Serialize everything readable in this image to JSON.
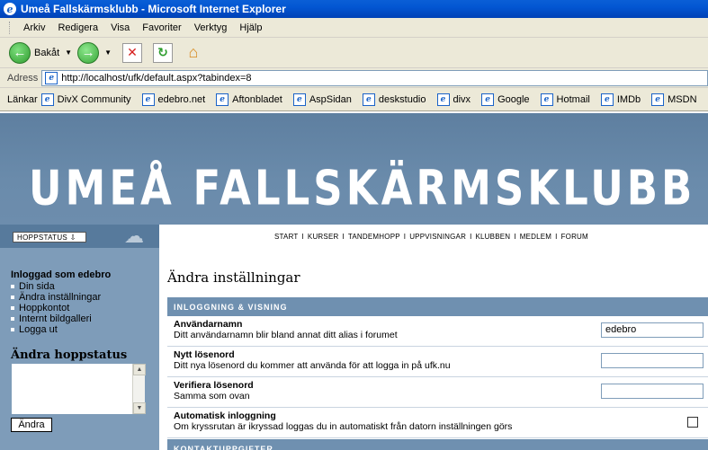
{
  "window": {
    "title": "Umeå Fallskärmsklubb - Microsoft Internet Explorer"
  },
  "menu": {
    "items": [
      "Arkiv",
      "Redigera",
      "Visa",
      "Favoriter",
      "Verktyg",
      "Hjälp"
    ]
  },
  "toolbar": {
    "back_label": "Bakåt"
  },
  "address": {
    "label": "Adress",
    "url": "http://localhost/ufk/default.aspx?tabindex=8"
  },
  "links": {
    "label": "Länkar",
    "items": [
      "DivX Community",
      "edebro.net",
      "Aftonbladet",
      "AspSidan",
      "deskstudio",
      "divx",
      "Google",
      "Hotmail",
      "IMDb",
      "MSDN"
    ]
  },
  "site": {
    "title": "UMEÅ FALLSKÄRMSKLUBB",
    "hoppstatus_button": "HOPPSTATUS ⇩",
    "nav": [
      "START",
      "KURSER",
      "TANDEMHOPP",
      "UPPVISNINGAR",
      "KLUBBEN",
      "MEDLEM",
      "FORUM"
    ],
    "nav_sep": "I"
  },
  "sidebar": {
    "logged_in": "Inloggad som edebro",
    "items": [
      "Din sida",
      "Ändra inställningar",
      "Hoppkontot",
      "Internt bildgalleri",
      "Logga ut"
    ],
    "status_title": "Ändra hoppstatus",
    "status_button": "Ändra"
  },
  "main": {
    "title": "Ändra inställningar",
    "section1": "INLOGGNING & VISNING",
    "section2": "KONTAKTUPPGIFTER",
    "rows": [
      {
        "label": "Användarnamn",
        "desc": "Ditt användarnamn blir bland annat ditt alias i forumet",
        "value": "edebro"
      },
      {
        "label": "Nytt lösenord",
        "desc": "Ditt nya lösenord du kommer att använda för att logga in på ufk.nu",
        "value": ""
      },
      {
        "label": "Verifiera lösenord",
        "desc": "Samma som ovan",
        "value": ""
      },
      {
        "label": "Automatisk inloggning",
        "desc": "Om kryssrutan är ikryssad loggas du in automatiskt från datorn inställningen görs",
        "checked": false
      }
    ]
  }
}
